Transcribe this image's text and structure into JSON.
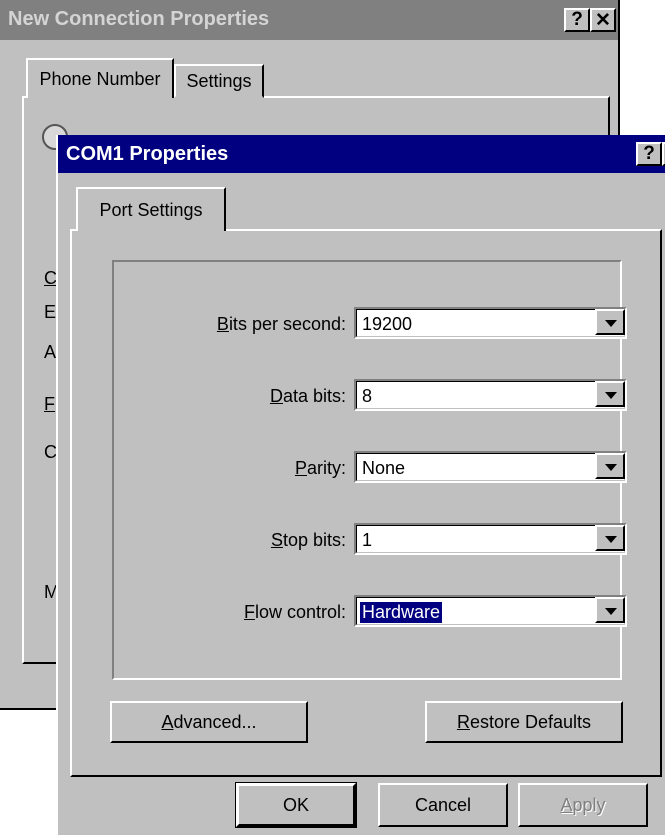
{
  "back_window": {
    "title": "New Connection Properties",
    "help_glyph": "?",
    "close_glyph": "✕",
    "tabs": [
      "Phone Number",
      "Settings"
    ],
    "peek_letters": [
      "C",
      "E",
      "A",
      "F",
      "C",
      "M"
    ]
  },
  "dialog": {
    "title": "COM1 Properties",
    "help_glyph": "?",
    "close_glyph": "✕",
    "tab": "Port Settings",
    "fields": [
      {
        "hotkey": "B",
        "rest": "its per second:",
        "value": "19200"
      },
      {
        "hotkey": "D",
        "rest": "ata bits:",
        "value": "8"
      },
      {
        "hotkey": "P",
        "rest": "arity:",
        "value": "None"
      },
      {
        "hotkey": "S",
        "rest": "top bits:",
        "value": "1"
      },
      {
        "hotkey": "F",
        "rest": "low control:",
        "value": "Hardware"
      }
    ],
    "buttons": {
      "advanced_hotkey": "A",
      "advanced_rest": "dvanced...",
      "restore_hotkey": "R",
      "restore_rest": "estore Defaults",
      "ok": "OK",
      "cancel": "Cancel",
      "apply_hotkey": "A",
      "apply_rest": "pply"
    }
  }
}
